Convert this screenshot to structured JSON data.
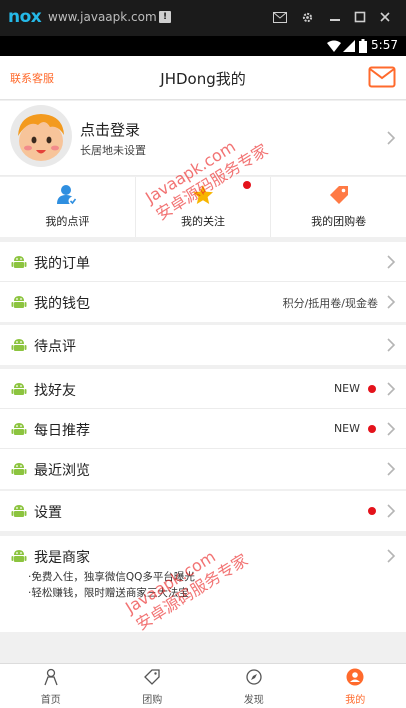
{
  "emulator": {
    "logo": "nox",
    "title": "www.javaapk.com",
    "badge": "!",
    "icons": [
      "mail-icon",
      "gear-icon",
      "minimize-icon",
      "maximize-icon",
      "close-icon"
    ]
  },
  "status_bar": {
    "time": "5:57",
    "icons": [
      "wifi-icon",
      "signal-icon",
      "battery-icon"
    ]
  },
  "header": {
    "contact_label": "联系客服",
    "title": "JHDong我的"
  },
  "profile": {
    "login_label": "点击登录",
    "location": "长居地未设置"
  },
  "quick_actions": [
    {
      "label": "我的点评",
      "icon": "review-person-icon",
      "has_dot": false
    },
    {
      "label": "我的关注",
      "icon": "star-icon",
      "has_dot": true
    },
    {
      "label": "我的团购卷",
      "icon": "coupon-tag-icon",
      "has_dot": false
    }
  ],
  "menu": {
    "orders": "我的订单",
    "wallet": "我的钱包",
    "wallet_extra": "积分/抵用卷/现金卷",
    "pending_review": "待点评",
    "find_friends": "找好友",
    "find_friends_badge": "NEW",
    "daily_recommend": "每日推荐",
    "daily_recommend_badge": "NEW",
    "recent_browse": "最近浏览",
    "settings": "设置",
    "merchant": "我是商家",
    "merchant_notes": [
      "·免费入住，独享微信QQ多平台曝光",
      "·轻松赚钱，限时赠送商家三大法宝"
    ]
  },
  "watermark": {
    "line1": "Javaapk.com",
    "line2": "安卓源码服务专家"
  },
  "bottom_nav": [
    {
      "label": "首页",
      "icon": "home-icon",
      "active": false
    },
    {
      "label": "团购",
      "icon": "group-buy-icon",
      "active": false
    },
    {
      "label": "发现",
      "icon": "discover-icon",
      "active": false
    },
    {
      "label": "我的",
      "icon": "profile-icon",
      "active": true
    }
  ],
  "colors": {
    "accent": "#ff6a2c",
    "red_dot": "#e4121b",
    "background": "#f0f0f0",
    "android_green": "#8cc43f"
  }
}
